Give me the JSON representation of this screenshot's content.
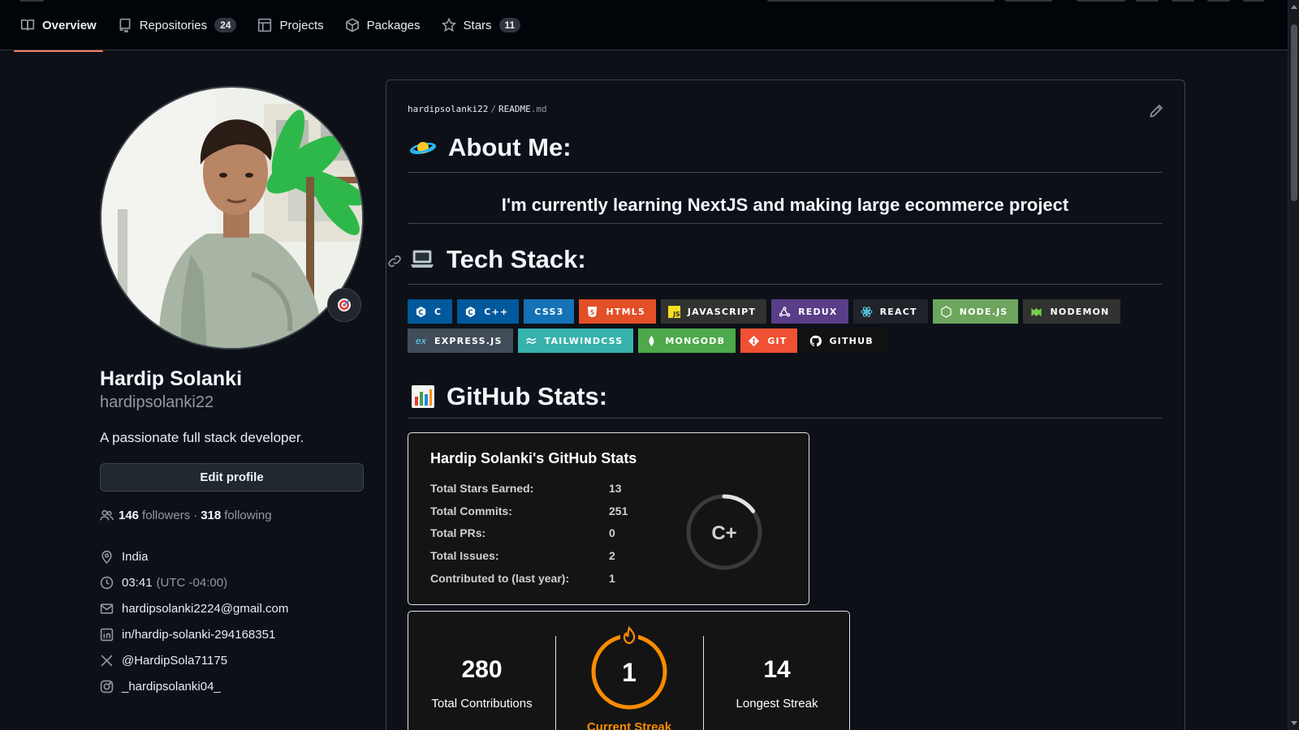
{
  "nav": {
    "tabs": [
      {
        "label": "Overview",
        "icon": "book-icon",
        "active": true
      },
      {
        "label": "Repositories",
        "icon": "repo-icon",
        "count": "24"
      },
      {
        "label": "Projects",
        "icon": "table-icon"
      },
      {
        "label": "Packages",
        "icon": "package-icon"
      },
      {
        "label": "Stars",
        "icon": "star-icon",
        "count": "11"
      }
    ]
  },
  "profile": {
    "name": "Hardip Solanki",
    "login": "hardipsolanki22",
    "bio": "A passionate full stack developer.",
    "edit_label": "Edit profile",
    "followers": "146",
    "followers_label": "followers",
    "following": "318",
    "following_label": "following",
    "location": "India",
    "time": "03:41",
    "timezone": "(UTC -04:00)",
    "email": "hardipsolanki2224@gmail.com",
    "linkedin": "in/hardip-solanki-294168351",
    "twitter": "@HardipSola71175",
    "instagram": "_hardipsolanki04_"
  },
  "readme": {
    "owner": "hardipsolanki22",
    "file": "README",
    "ext": ".md",
    "about_heading": "About Me:",
    "learning": "I'm currently learning NextJS and making large ecommerce project",
    "tech_heading": "Tech Stack:",
    "stats_heading": "GitHub Stats:",
    "badges": [
      {
        "label": "C",
        "color": "#00599C",
        "icon": "c-logo-icon"
      },
      {
        "label": "C++",
        "color": "#00599C",
        "icon": "cpp-logo-icon"
      },
      {
        "label": "CSS3",
        "color": "#1572B6",
        "icon": "css3-logo-icon"
      },
      {
        "label": "HTML5",
        "color": "#E34F26",
        "icon": "html5-logo-icon"
      },
      {
        "label": "JAVASCRIPT",
        "color": "#323330",
        "icon": "javascript-logo-icon"
      },
      {
        "label": "REDUX",
        "color": "#593D88",
        "icon": "redux-logo-icon"
      },
      {
        "label": "REACT",
        "color": "#20232A",
        "icon": "react-logo-icon"
      },
      {
        "label": "NODE.JS",
        "color": "#6DA55F",
        "icon": "nodejs-logo-icon"
      },
      {
        "label": "NODEMON",
        "color": "#323330",
        "icon": "nodemon-logo-icon"
      },
      {
        "label": "EXPRESS.JS",
        "color": "#404D59",
        "icon": "express-logo-icon"
      },
      {
        "label": "TAILWINDCSS",
        "color": "#38B2AC",
        "icon": "tailwind-logo-icon"
      },
      {
        "label": "MONGODB",
        "color": "#4EA94B",
        "icon": "mongodb-logo-icon"
      },
      {
        "label": "GIT",
        "color": "#F05033",
        "icon": "git-logo-icon"
      },
      {
        "label": "GITHUB",
        "color": "#121011",
        "icon": "github-logo-icon"
      }
    ]
  },
  "stats": {
    "title": "Hardip Solanki's GitHub Stats",
    "rows": [
      {
        "label": "Total Stars Earned:",
        "value": "13"
      },
      {
        "label": "Total Commits:",
        "value": "251"
      },
      {
        "label": "Total PRs:",
        "value": "0"
      },
      {
        "label": "Total Issues:",
        "value": "2"
      },
      {
        "label": "Contributed to (last year):",
        "value": "1"
      }
    ],
    "grade": "C+",
    "grade_ring_fraction": 0.15
  },
  "streak": {
    "total": "280",
    "total_label": "Total Contributions",
    "current": "1",
    "current_label": "Current Streak",
    "longest": "14",
    "longest_label": "Longest Streak",
    "accent": "#FB8C00"
  }
}
